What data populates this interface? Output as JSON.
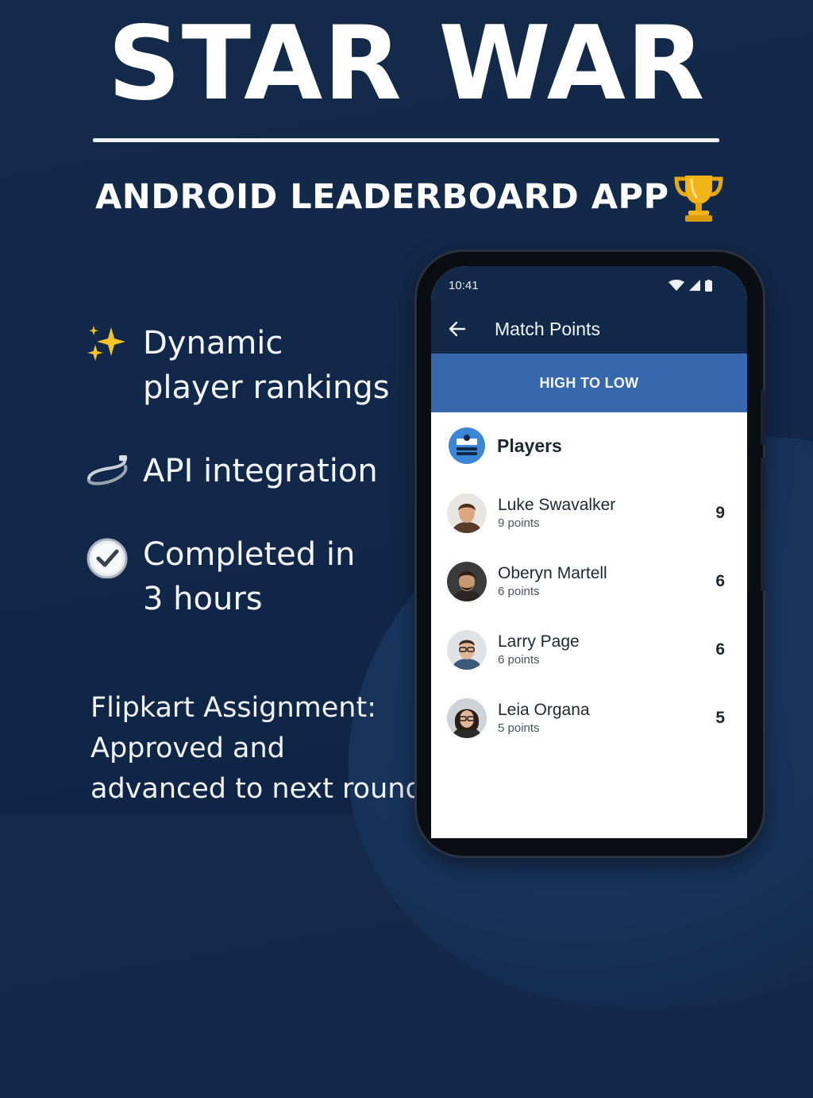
{
  "hero": {
    "title": "STAR WAR",
    "subtitle": "ANDROID LEADERBOARD APP",
    "subtitle_icon": "trophy-icon"
  },
  "features": [
    {
      "icon": "sparkles-icon",
      "line1": "Dynamic",
      "line2": "player rankings"
    },
    {
      "icon": "cable-icon",
      "line1": "API integration",
      "line2": ""
    },
    {
      "icon": "check-circle-icon",
      "line1": "Completed in",
      "line2": "3 hours"
    }
  ],
  "footer": {
    "line1": "Flipkart Assignment:",
    "line2": "Approved and",
    "line3": "advanced to next round"
  },
  "phone": {
    "status": {
      "time": "10:41",
      "icons": [
        "wifi-icon",
        "signal-icon",
        "battery-icon"
      ]
    },
    "appbar": {
      "title": "Match Points",
      "back_icon": "back-arrow-icon"
    },
    "sort_label": "HIGH TO LOW",
    "players_label": "Players",
    "players": [
      {
        "name": "Luke Swavalker",
        "points_label": "9 points",
        "score": "9"
      },
      {
        "name": "Oberyn Martell",
        "points_label": "6 points",
        "score": "6"
      },
      {
        "name": "Larry Page",
        "points_label": "6 points",
        "score": "6"
      },
      {
        "name": "Leia Organa",
        "points_label": "5 points",
        "score": "5"
      }
    ]
  },
  "colors": {
    "background": "#132a4a",
    "app_bar": "#13294a",
    "sort_bar": "#3767ad",
    "accent_icon": "#3c86d6"
  }
}
